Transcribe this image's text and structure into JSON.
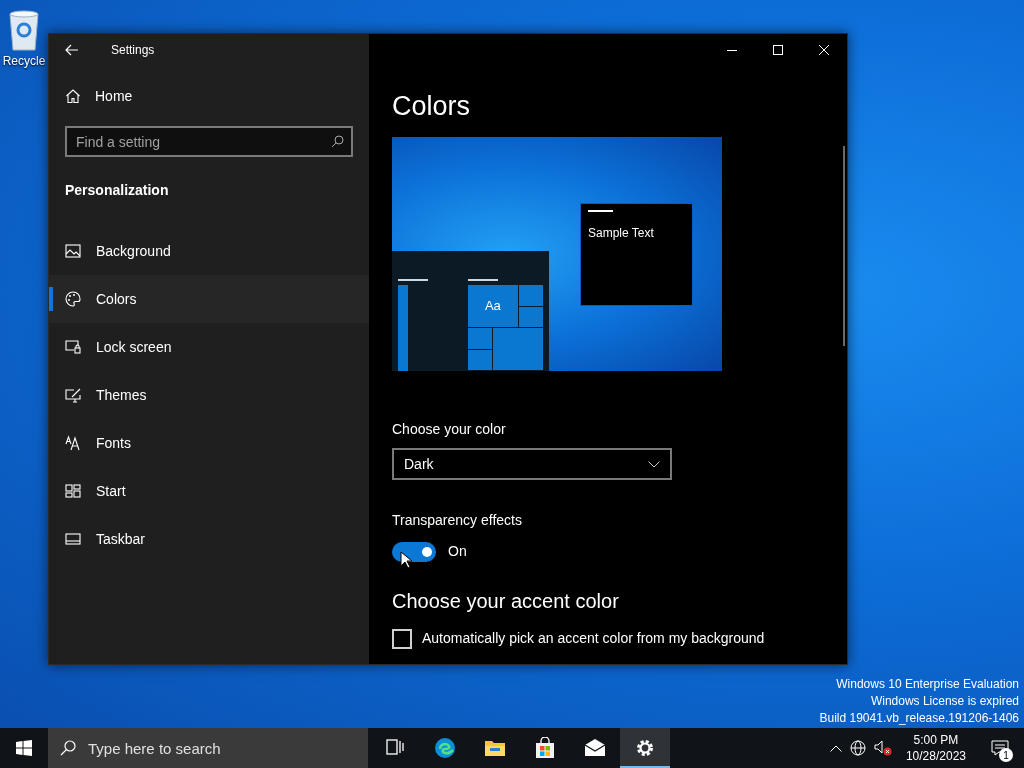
{
  "desktop": {
    "icons": [
      {
        "label": "Recycle"
      }
    ],
    "watermark": [
      "Windows 10 Enterprise Evaluation",
      "Windows License is expired",
      "Build 19041.vb_release.191206-1406"
    ]
  },
  "window": {
    "title": "Settings"
  },
  "sidebar": {
    "home": "Home",
    "search": {
      "placeholder": "Find a setting"
    },
    "section": "Personalization",
    "items": [
      {
        "label": "Background",
        "kind": "background",
        "selected": false
      },
      {
        "label": "Colors",
        "kind": "colors",
        "selected": true
      },
      {
        "label": "Lock screen",
        "kind": "lock",
        "selected": false
      },
      {
        "label": "Themes",
        "kind": "themes",
        "selected": false
      },
      {
        "label": "Fonts",
        "kind": "fonts",
        "selected": false
      },
      {
        "label": "Start",
        "kind": "start",
        "selected": false
      },
      {
        "label": "Taskbar",
        "kind": "taskbar",
        "selected": false
      }
    ]
  },
  "content": {
    "title": "Colors",
    "preview": {
      "sample_text": "Sample Text",
      "tile_text": "Aa"
    },
    "color_mode": {
      "label": "Choose your color",
      "value": "Dark"
    },
    "transparency": {
      "label": "Transparency effects",
      "on": true,
      "state_text": "On"
    },
    "accent_heading": "Choose your accent color",
    "auto_accent": {
      "label": "Automatically pick an accent color from my background",
      "checked": false
    }
  },
  "taskbar": {
    "search_placeholder": "Type here to search",
    "apps": [
      {
        "kind": "task-view",
        "selected": false
      },
      {
        "kind": "browser",
        "selected": false
      },
      {
        "kind": "folder",
        "selected": false
      },
      {
        "kind": "store",
        "selected": false
      },
      {
        "kind": "mail",
        "selected": false
      },
      {
        "kind": "settings",
        "selected": true
      }
    ],
    "time": "5:00 PM",
    "date": "10/28/2023",
    "notification_count": "1"
  }
}
